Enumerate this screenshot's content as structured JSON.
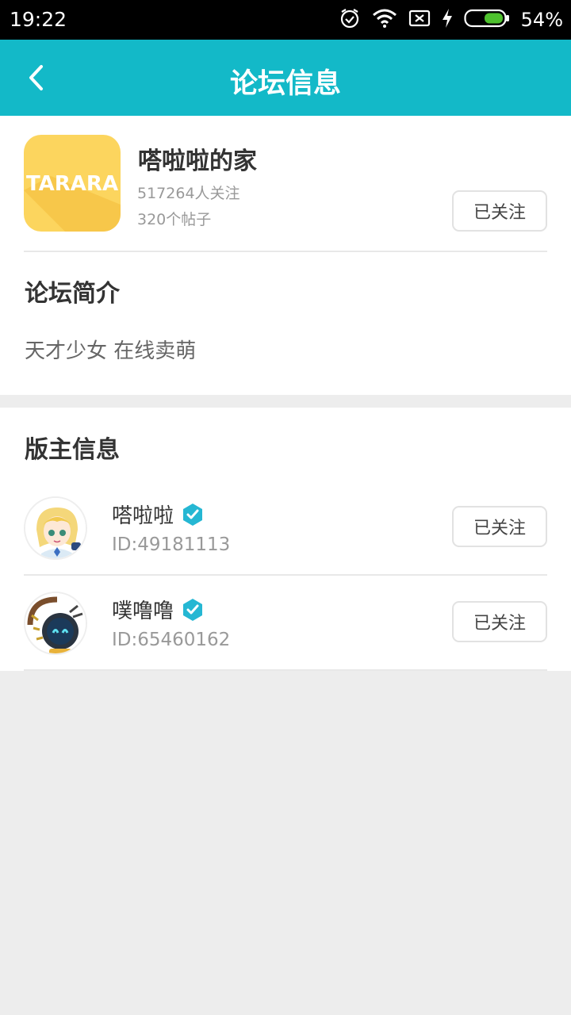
{
  "status_bar": {
    "time": "19:22",
    "battery": "54%"
  },
  "header": {
    "title": "论坛信息"
  },
  "forum": {
    "logo_text": "TARARA",
    "name": "嗒啦啦的家",
    "followers": "517264人关注",
    "posts": "320个帖子",
    "follow_label": "已关注",
    "intro_title": "论坛简介",
    "intro_text": "天才少女 在线卖萌"
  },
  "moderators": {
    "title": "版主信息",
    "items": [
      {
        "name": "嗒啦啦",
        "id": "ID:49181113",
        "follow_label": "已关注"
      },
      {
        "name": "噗噜噜",
        "id": "ID:65460162",
        "follow_label": "已关注"
      }
    ]
  },
  "colors": {
    "accent": "#13b9c8",
    "logo_bg": "#fcd55e",
    "verified": "#25b7d3"
  }
}
